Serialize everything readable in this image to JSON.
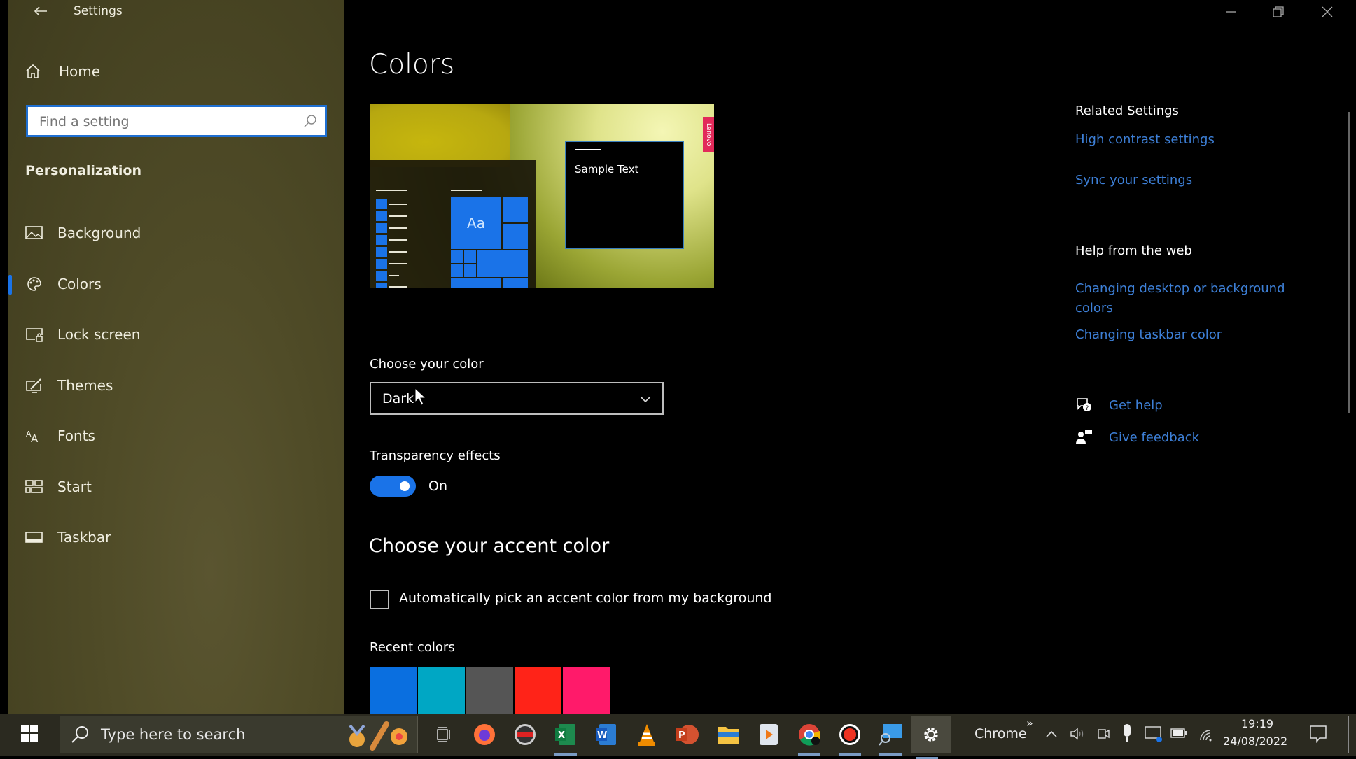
{
  "window": {
    "app_title": "Settings",
    "page_title": "Colors",
    "controls": {
      "minimize": "minimize-icon",
      "restore": "restore-icon",
      "close": "close-icon"
    }
  },
  "sidebar": {
    "home_label": "Home",
    "search_placeholder": "Find a setting",
    "section_title": "Personalization",
    "items": [
      {
        "label": "Background",
        "icon": "picture-icon"
      },
      {
        "label": "Colors",
        "icon": "palette-icon",
        "active": true
      },
      {
        "label": "Lock screen",
        "icon": "lock-screen-icon"
      },
      {
        "label": "Themes",
        "icon": "themes-icon"
      },
      {
        "label": "Fonts",
        "icon": "fonts-icon"
      },
      {
        "label": "Start",
        "icon": "start-icon"
      },
      {
        "label": "Taskbar",
        "icon": "taskbar-icon"
      }
    ]
  },
  "preview": {
    "sample_text": "Sample Text",
    "tile_text": "Aa",
    "brand_tag": "Lenovo"
  },
  "main": {
    "choose_color_label": "Choose your color",
    "choose_color_value": "Dark",
    "transparency_label": "Transparency effects",
    "transparency_state": "On",
    "transparency_on": true,
    "accent_title": "Choose your accent color",
    "auto_pick_label": "Automatically pick an accent color from my background",
    "auto_pick_checked": false,
    "recent_colors_label": "Recent colors",
    "recent_colors": [
      "#0a6fe0",
      "#00a7c4",
      "#555555",
      "#ff2318",
      "#ff1a6a"
    ]
  },
  "right": {
    "related_title": "Related Settings",
    "related_links": [
      "High contrast settings",
      "Sync your settings"
    ],
    "help_title": "Help from the web",
    "help_links": [
      "Changing desktop or background colors",
      "Changing taskbar color"
    ],
    "get_help": "Get help",
    "give_feedback": "Give feedback"
  },
  "taskbar": {
    "search_placeholder": "Type here to search",
    "apps": [
      {
        "name": "task-view"
      },
      {
        "name": "firefox"
      },
      {
        "name": "recorder"
      },
      {
        "name": "excel",
        "glyph": "X"
      },
      {
        "name": "word",
        "glyph": "W"
      },
      {
        "name": "vlc"
      },
      {
        "name": "powerpoint",
        "glyph": "P"
      },
      {
        "name": "file-explorer"
      },
      {
        "name": "media-player"
      },
      {
        "name": "chrome"
      },
      {
        "name": "record"
      },
      {
        "name": "remote-desktop"
      },
      {
        "name": "settings"
      }
    ],
    "toolbar_label": "Chrome",
    "toolbar_more": "»",
    "time": "19:19",
    "date": "24/08/2022"
  },
  "colors": {
    "accent": "#1a73e8",
    "link": "#3d7fd6"
  }
}
